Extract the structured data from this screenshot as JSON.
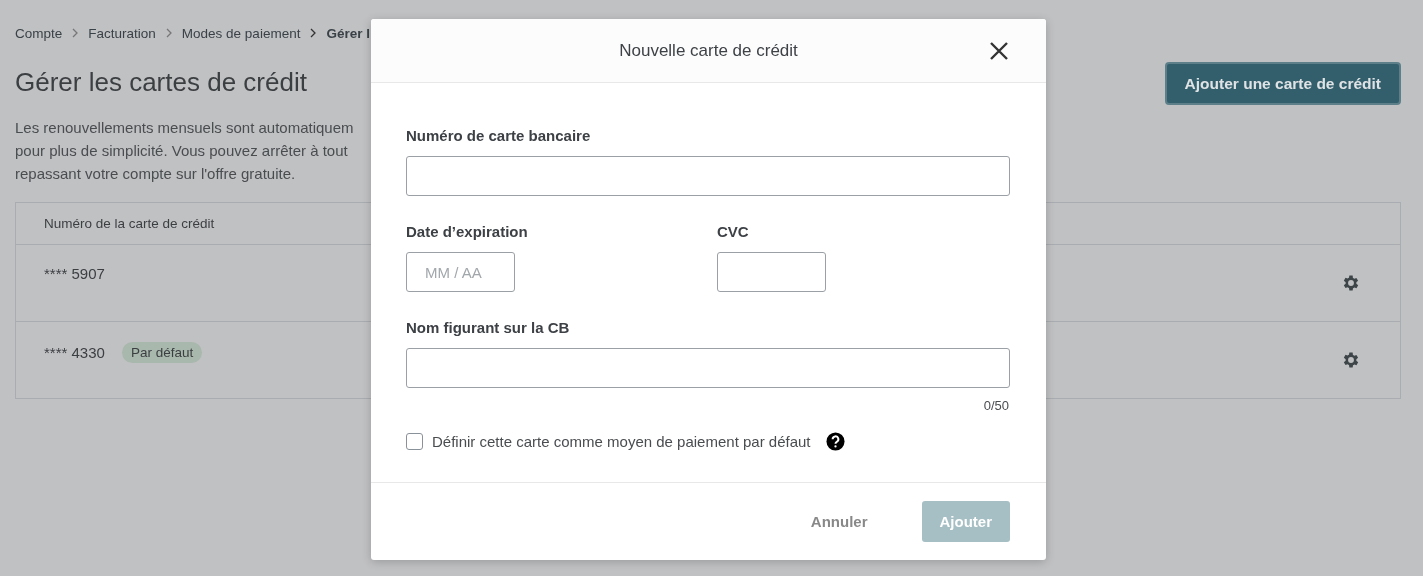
{
  "breadcrumb": [
    {
      "label": "Compte",
      "current": false
    },
    {
      "label": "Facturation",
      "current": false
    },
    {
      "label": "Modes de paiement",
      "current": false
    },
    {
      "label": "Gérer l",
      "current": true
    }
  ],
  "page": {
    "title": "Gérer les cartes de crédit",
    "description_lines": [
      "Les renouvellements mensuels sont automatiquem",
      "pour plus de simplicité. Vous pouvez arrêter à tout",
      "repassant votre compte sur l'offre gratuite."
    ],
    "add_button": "Ajouter une carte de crédit"
  },
  "table": {
    "columns": [
      "Numéro de la carte de crédit"
    ],
    "rows": [
      {
        "card": "**** 5907"
      },
      {
        "card": "**** 4330",
        "badge": "Par défaut"
      }
    ]
  },
  "dialog": {
    "title": "Nouvelle carte de crédit",
    "fields": [
      {
        "kind": "wide",
        "label": "Numéro de carte bancaire"
      },
      {
        "kind": "short",
        "label": "Date d’expiration",
        "placeholder": "MM / AA"
      },
      {
        "kind": "short",
        "label": "CVC"
      },
      {
        "kind": "wide",
        "label": "Nom figurant sur la CB",
        "counter": "0/50"
      }
    ],
    "checkbox": {
      "label": "Définir cette carte comme moyen de paiement par défaut",
      "checked": false
    },
    "buttons": [
      {
        "kind": "text",
        "label": "Annuler"
      },
      {
        "kind": "primary",
        "label": "Ajouter",
        "disabled": true
      }
    ]
  }
}
